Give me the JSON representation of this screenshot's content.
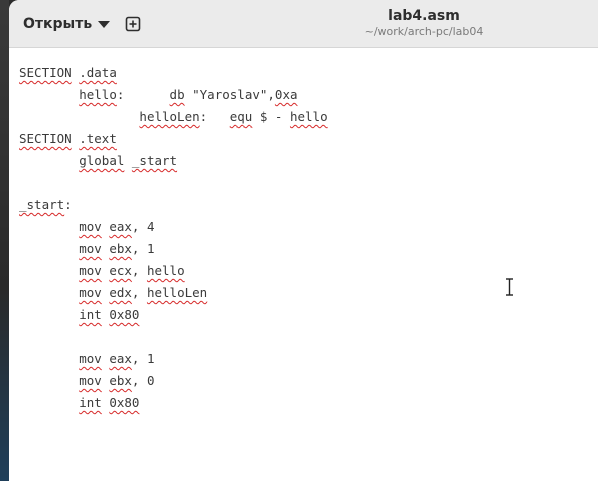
{
  "header": {
    "open_label": "Открыть",
    "title": "lab4.asm",
    "subtitle": "~/work/arch-pc/lab04"
  },
  "icons": {
    "open_menu": "chevron-down-icon",
    "new_tab": "new-tab-icon",
    "cursor": "text-cursor-icon"
  },
  "colors": {
    "spellcheck_underline": "#d62828",
    "header_bg": "#ebebeb",
    "editor_bg": "#ffffff"
  },
  "editor": {
    "lines": [
      [
        {
          "t": "SECTION",
          "s": true
        },
        {
          "t": " "
        },
        {
          "t": ".data",
          "s": true
        }
      ],
      [
        {
          "t": "        "
        },
        {
          "t": "hello",
          "s": true
        },
        {
          "t": ":      "
        },
        {
          "t": "db",
          "s": true
        },
        {
          "t": " \"Yaroslav\","
        },
        {
          "t": "0xa",
          "s": true
        }
      ],
      [
        {
          "t": "                "
        },
        {
          "t": "helloLen",
          "s": true
        },
        {
          "t": ":   "
        },
        {
          "t": "equ",
          "s": true
        },
        {
          "t": " $ - "
        },
        {
          "t": "hello",
          "s": true
        }
      ],
      [
        {
          "t": "SECTION",
          "s": true
        },
        {
          "t": " "
        },
        {
          "t": ".text",
          "s": true
        }
      ],
      [
        {
          "t": "        "
        },
        {
          "t": "global",
          "s": true
        },
        {
          "t": " "
        },
        {
          "t": "_start",
          "s": true
        }
      ],
      [],
      [
        {
          "t": "_start",
          "s": true
        },
        {
          "t": ":"
        }
      ],
      [
        {
          "t": "        "
        },
        {
          "t": "mov",
          "s": true
        },
        {
          "t": " "
        },
        {
          "t": "eax",
          "s": true
        },
        {
          "t": ", 4"
        }
      ],
      [
        {
          "t": "        "
        },
        {
          "t": "mov",
          "s": true
        },
        {
          "t": " "
        },
        {
          "t": "ebx",
          "s": true
        },
        {
          "t": ", 1"
        }
      ],
      [
        {
          "t": "        "
        },
        {
          "t": "mov",
          "s": true
        },
        {
          "t": " "
        },
        {
          "t": "ecx",
          "s": true
        },
        {
          "t": ", "
        },
        {
          "t": "hello",
          "s": true
        }
      ],
      [
        {
          "t": "        "
        },
        {
          "t": "mov",
          "s": true
        },
        {
          "t": " "
        },
        {
          "t": "edx",
          "s": true
        },
        {
          "t": ", "
        },
        {
          "t": "helloLen",
          "s": true
        }
      ],
      [
        {
          "t": "        "
        },
        {
          "t": "int",
          "s": true
        },
        {
          "t": " "
        },
        {
          "t": "0x80",
          "s": true
        }
      ],
      [],
      [
        {
          "t": "        "
        },
        {
          "t": "mov",
          "s": true
        },
        {
          "t": " "
        },
        {
          "t": "eax",
          "s": true
        },
        {
          "t": ", 1"
        }
      ],
      [
        {
          "t": "        "
        },
        {
          "t": "mov",
          "s": true
        },
        {
          "t": " "
        },
        {
          "t": "ebx",
          "s": true
        },
        {
          "t": ", 0"
        }
      ],
      [
        {
          "t": "        "
        },
        {
          "t": "int",
          "s": true
        },
        {
          "t": " "
        },
        {
          "t": "0x80",
          "s": true
        }
      ]
    ]
  }
}
